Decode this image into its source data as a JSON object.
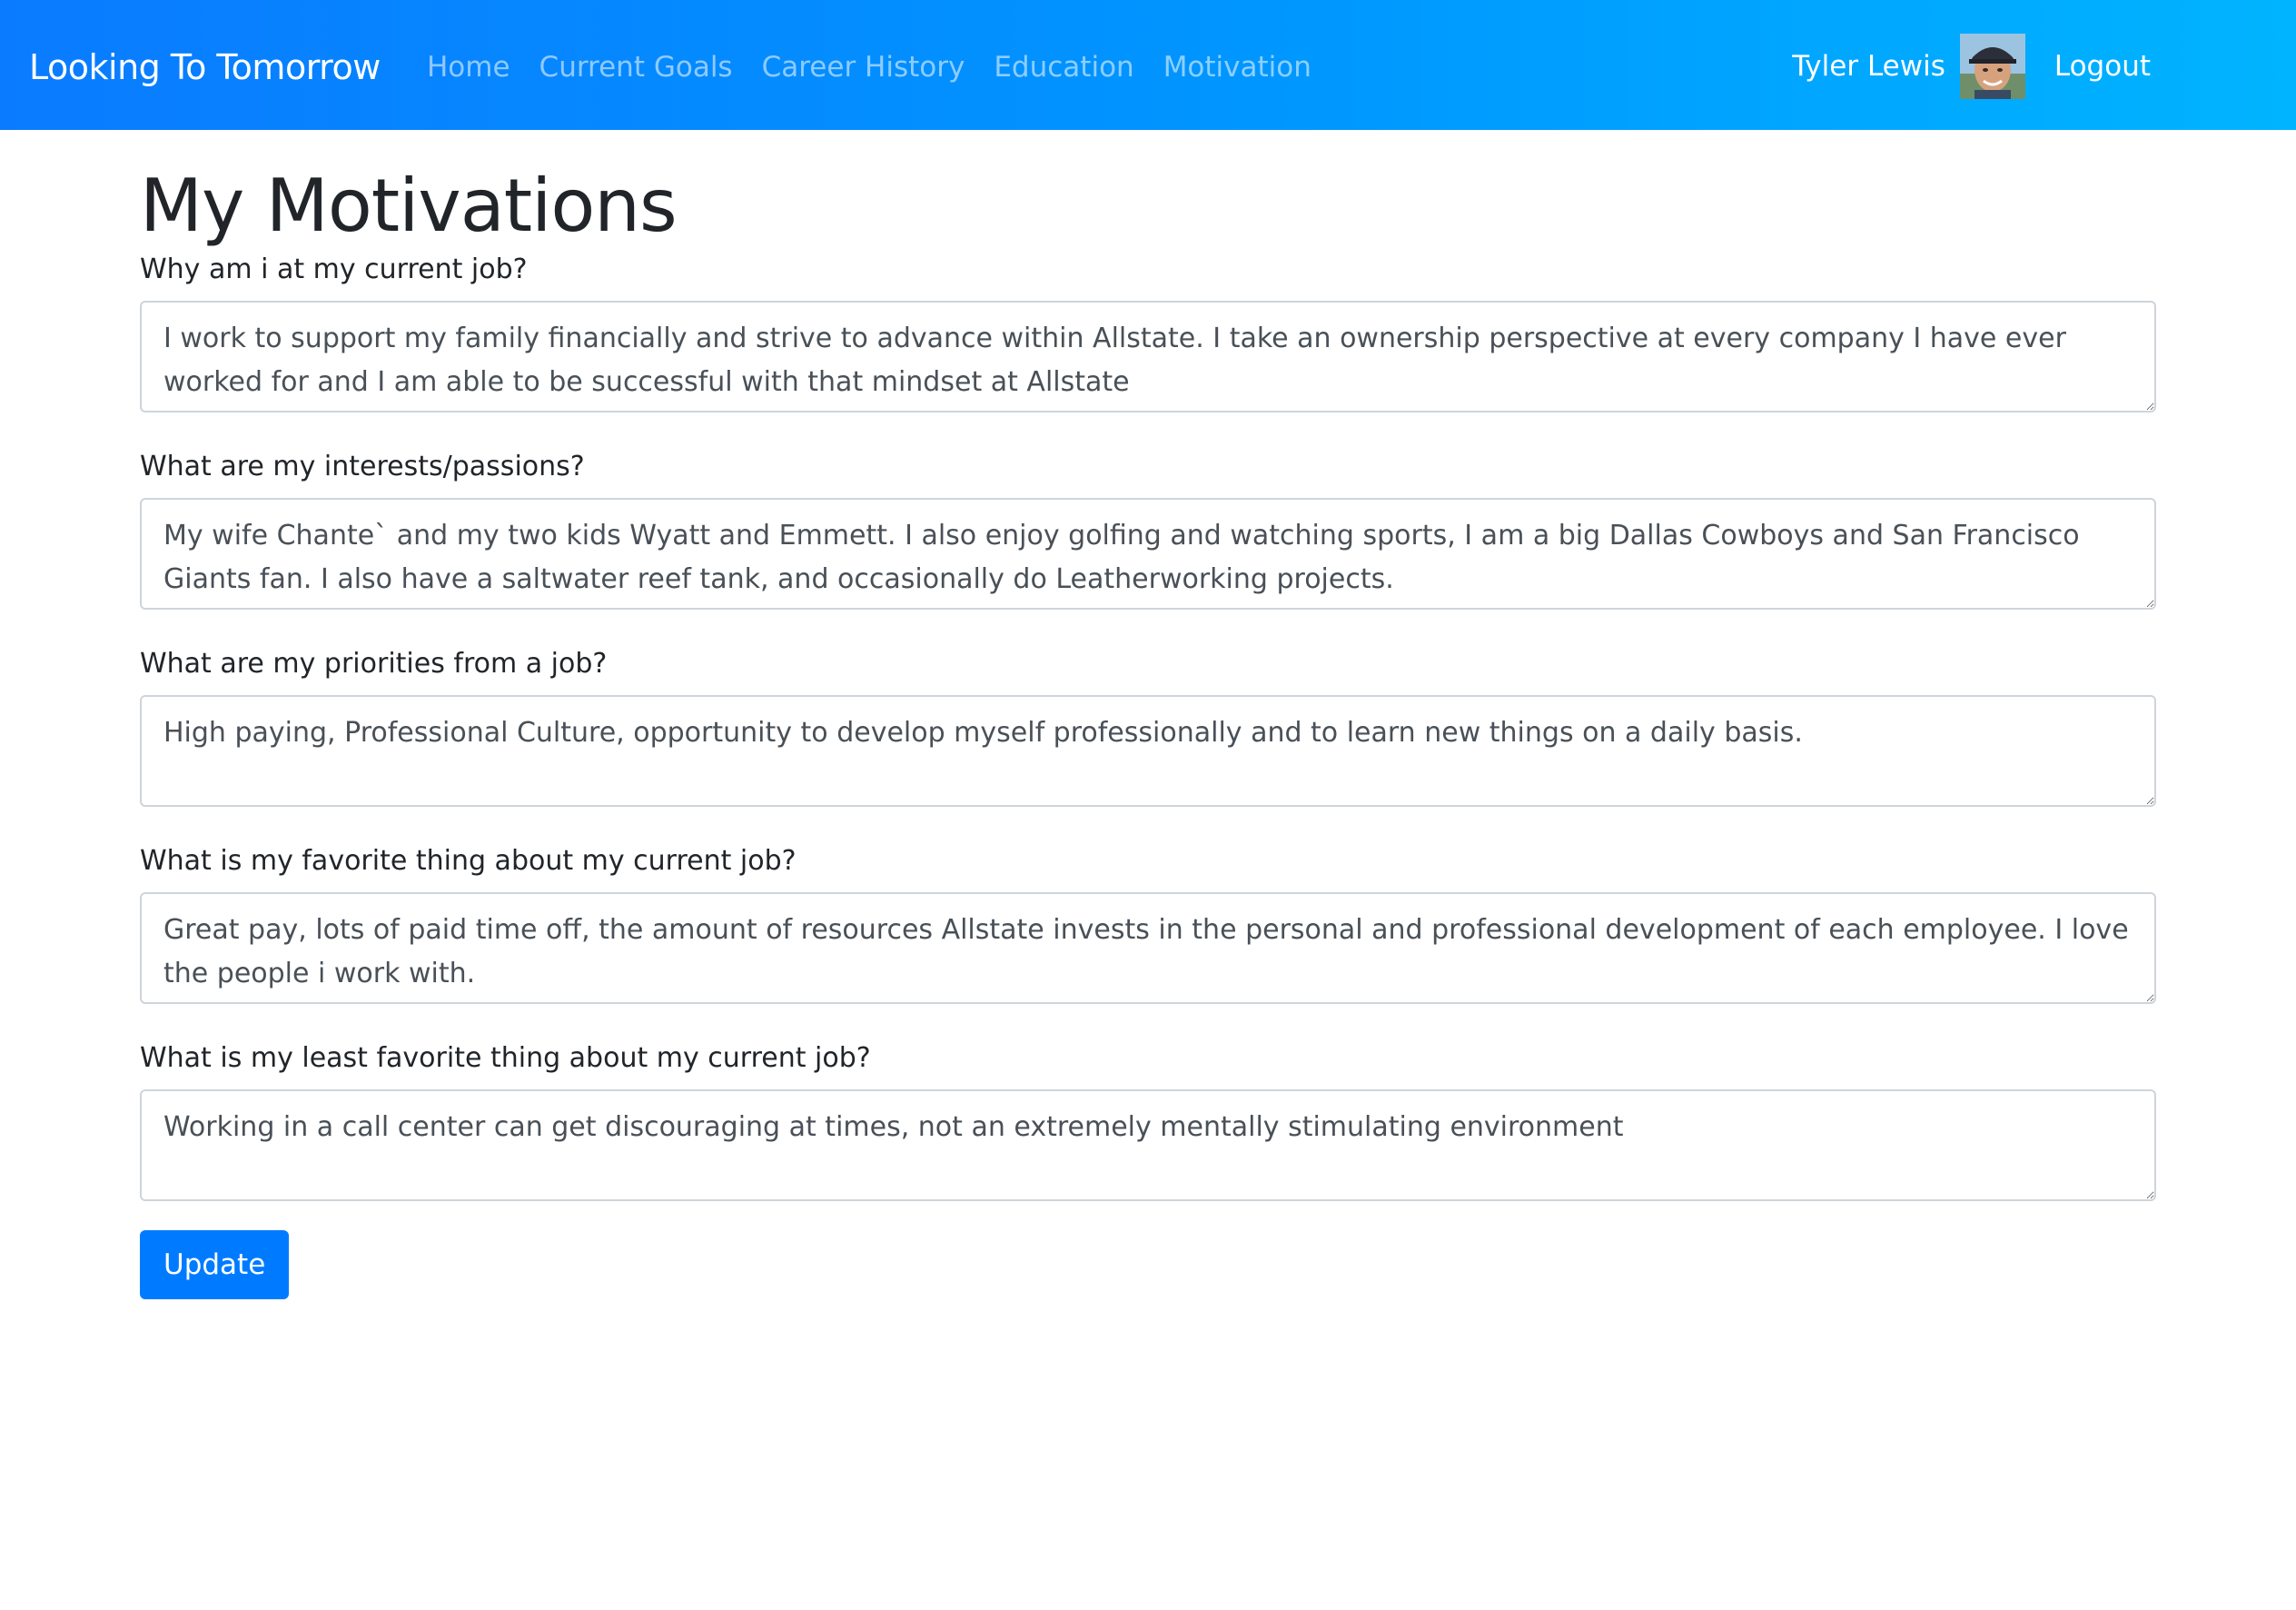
{
  "navbar": {
    "brand": "Looking To Tomorrow",
    "links": [
      {
        "label": "Home"
      },
      {
        "label": "Current Goals"
      },
      {
        "label": "Career History"
      },
      {
        "label": "Education"
      },
      {
        "label": "Motivation"
      }
    ],
    "user_name": "Tyler Lewis",
    "logout_label": "Logout",
    "gradient_start": "#0a7bff",
    "gradient_end": "#00b4ff"
  },
  "page": {
    "title": "My Motivations"
  },
  "questions": [
    {
      "label": "Why am i at my current job?",
      "answer": "I work to support my family financially and strive to advance within Allstate. I take an ownership perspective at every company I have ever worked for and I am able to be successful with that mindset at Allstate"
    },
    {
      "label": "What are my interests/passions?",
      "answer": "My wife Chante` and my two kids Wyatt and Emmett. I also enjoy golfing and watching sports, I am a big Dallas Cowboys and San Francisco Giants fan. I also have a saltwater reef tank, and occasionally do Leatherworking projects."
    },
    {
      "label": "What are my priorities from a job?",
      "answer": "High paying, Professional Culture, opportunity to develop myself professionally and to learn new things on a daily basis."
    },
    {
      "label": "What is my favorite thing about my current job?",
      "answer": "Great pay, lots of paid time off, the amount of resources Allstate invests in the personal and professional development of each employee. I love the people i work with."
    },
    {
      "label": "What is my least favorite thing about my current job?",
      "answer": "Working in a call center can get discouraging at times, not an extremely mentally stimulating environment"
    }
  ],
  "form": {
    "submit_label": "Update",
    "button_color": "#007bff"
  }
}
